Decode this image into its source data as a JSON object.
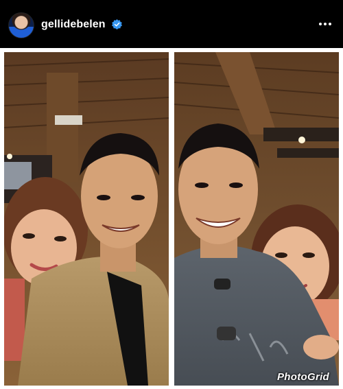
{
  "post_header": {
    "username": "gellidebelen",
    "verified_icon": "verified-badge-icon",
    "more_icon": "more-options-icon",
    "avatar_icon": "profile-avatar"
  },
  "photo": {
    "watermark": "PhotoGrid",
    "colors": {
      "border": "#ffffff",
      "verified": "#3897f0",
      "watermark_accent": "#ff4fa3"
    }
  }
}
